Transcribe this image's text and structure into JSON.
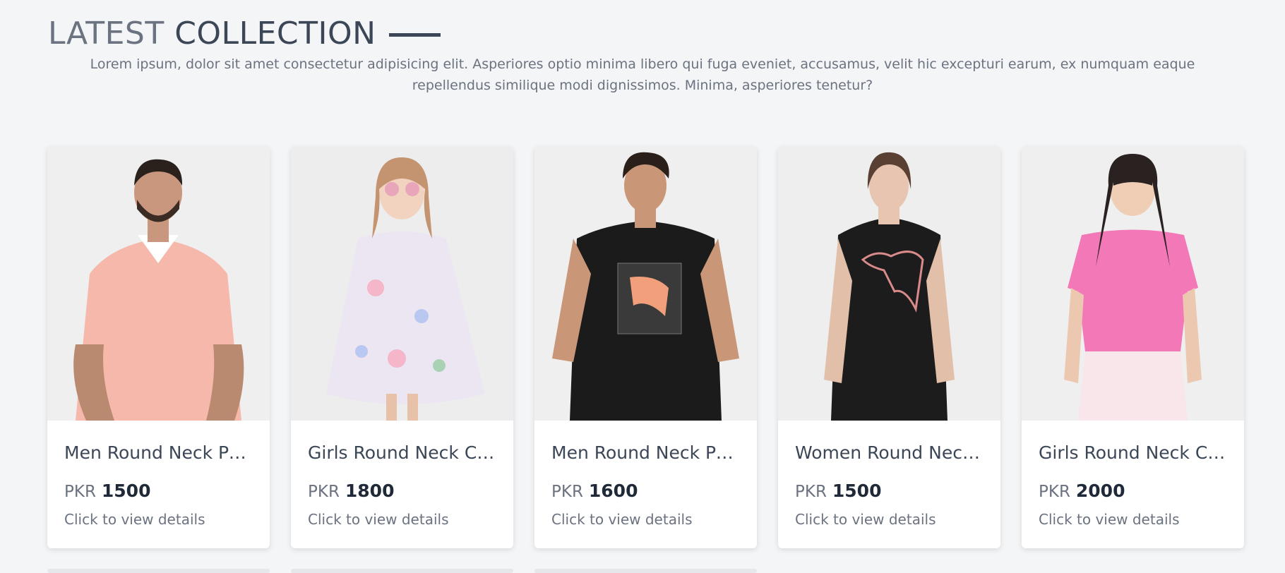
{
  "section": {
    "title_light": "LATEST",
    "title_dark": "COLLECTION",
    "description": "Lorem ipsum, dolor sit amet consectetur adipisicing elit. Asperiores optio minima libero qui fuga eveniet, accusamus, velit hic excepturi earum, ex numquam eaque repellendus similique modi dignissimos. Minima, asperiores tenetur?"
  },
  "products": [
    {
      "name": "Men Round Neck Pu...",
      "currency": "PKR",
      "price": "1500",
      "cta": "Click to view details",
      "shirt_color": "#f5b8aa",
      "image": "man-pink-polo"
    },
    {
      "name": "Girls Round Neck Co...",
      "currency": "PKR",
      "price": "1800",
      "cta": "Click to view details",
      "shirt_color": "#e9e3f1",
      "image": "girl-floral-dress"
    },
    {
      "name": "Men Round Neck Pu...",
      "currency": "PKR",
      "price": "1600",
      "cta": "Click to view details",
      "shirt_color": "#1a1a1a",
      "image": "man-black-puma-tee"
    },
    {
      "name": "Women Round Neck...",
      "currency": "PKR",
      "price": "1500",
      "cta": "Click to view details",
      "shirt_color": "#1c1c1c",
      "image": "woman-black-puma-tee"
    },
    {
      "name": "Girls Round Neck Co...",
      "currency": "PKR",
      "price": "2000",
      "cta": "Click to view details",
      "shirt_color": "#f378b8",
      "image": "girl-pink-top"
    }
  ]
}
